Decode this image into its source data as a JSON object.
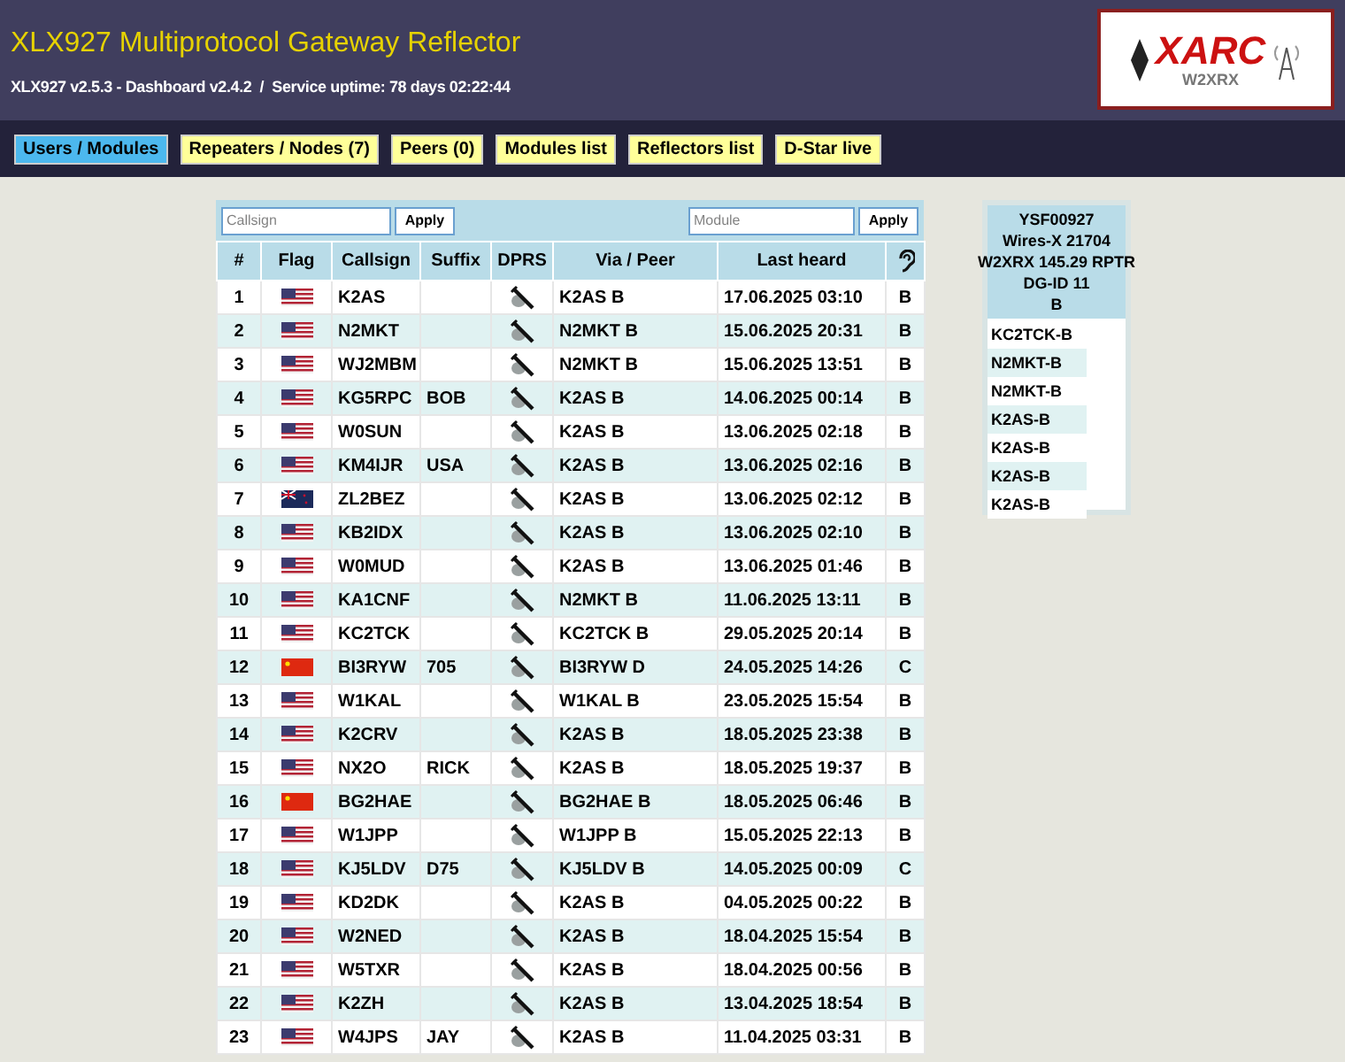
{
  "header": {
    "title": "XLX927 Multiprotocol Gateway Reflector",
    "subtitle": "XLX927 v2.5.3 - Dashboard v2.4.2  /  Service uptime: 78 days 02:22:44",
    "logo": {
      "name": "XARC",
      "call": "W2XRX"
    }
  },
  "nav": [
    {
      "label": "Users / Modules",
      "selected": true
    },
    {
      "label": "Repeaters / Nodes (7)",
      "selected": false
    },
    {
      "label": "Peers (0)",
      "selected": false
    },
    {
      "label": "Modules list",
      "selected": false
    },
    {
      "label": "Reflectors list",
      "selected": false
    },
    {
      "label": "D-Star live",
      "selected": false
    }
  ],
  "filters": [
    {
      "placeholder": "Callsign",
      "button": "Apply"
    },
    {
      "placeholder": "Module",
      "button": "Apply"
    }
  ],
  "table": {
    "columns": [
      "#",
      "Flag",
      "Callsign",
      "Suffix",
      "DPRS",
      "Via / Peer",
      "Last heard"
    ],
    "rows": [
      {
        "n": "1",
        "flag": {
          "kind": "us"
        },
        "callsign": "K2AS",
        "suffix": "",
        "via": "K2AS B",
        "last": "17.06.2025 03:10",
        "module": "B"
      },
      {
        "n": "2",
        "flag": {
          "kind": "us"
        },
        "callsign": "N2MKT",
        "suffix": "",
        "via": "N2MKT B",
        "last": "15.06.2025 20:31",
        "module": "B"
      },
      {
        "n": "3",
        "flag": {
          "kind": "us"
        },
        "callsign": "WJ2MBM",
        "suffix": "",
        "via": "N2MKT B",
        "last": "15.06.2025 13:51",
        "module": "B"
      },
      {
        "n": "4",
        "flag": {
          "kind": "us"
        },
        "callsign": "KG5RPC",
        "suffix": "BOB",
        "via": "K2AS B",
        "last": "14.06.2025 00:14",
        "module": "B"
      },
      {
        "n": "5",
        "flag": {
          "kind": "us"
        },
        "callsign": "W0SUN",
        "suffix": "",
        "via": "K2AS B",
        "last": "13.06.2025 02:18",
        "module": "B"
      },
      {
        "n": "6",
        "flag": {
          "kind": "us"
        },
        "callsign": "KM4IJR",
        "suffix": "USA",
        "via": "K2AS B",
        "last": "13.06.2025 02:16",
        "module": "B"
      },
      {
        "n": "7",
        "flag": {
          "kind": "nz"
        },
        "callsign": "ZL2BEZ",
        "suffix": "",
        "via": "K2AS B",
        "last": "13.06.2025 02:12",
        "module": "B"
      },
      {
        "n": "8",
        "flag": {
          "kind": "us"
        },
        "callsign": "KB2IDX",
        "suffix": "",
        "via": "K2AS B",
        "last": "13.06.2025 02:10",
        "module": "B"
      },
      {
        "n": "9",
        "flag": {
          "kind": "us"
        },
        "callsign": "W0MUD",
        "suffix": "",
        "via": "K2AS B",
        "last": "13.06.2025 01:46",
        "module": "B"
      },
      {
        "n": "10",
        "flag": {
          "kind": "us"
        },
        "callsign": "KA1CNF",
        "suffix": "",
        "via": "N2MKT B",
        "last": "11.06.2025 13:11",
        "module": "B"
      },
      {
        "n": "11",
        "flag": {
          "kind": "us"
        },
        "callsign": "KC2TCK",
        "suffix": "",
        "via": "KC2TCK B",
        "last": "29.05.2025 20:14",
        "module": "B"
      },
      {
        "n": "12",
        "flag": {
          "kind": "cn"
        },
        "callsign": "BI3RYW",
        "suffix": "705",
        "via": "BI3RYW D",
        "last": "24.05.2025 14:26",
        "module": "C"
      },
      {
        "n": "13",
        "flag": {
          "kind": "us"
        },
        "callsign": "W1KAL",
        "suffix": "",
        "via": "W1KAL B",
        "last": "23.05.2025 15:54",
        "module": "B"
      },
      {
        "n": "14",
        "flag": {
          "kind": "us"
        },
        "callsign": "K2CRV",
        "suffix": "",
        "via": "K2AS B",
        "last": "18.05.2025 23:38",
        "module": "B"
      },
      {
        "n": "15",
        "flag": {
          "kind": "us"
        },
        "callsign": "NX2O",
        "suffix": "RICK",
        "via": "K2AS B",
        "last": "18.05.2025 19:37",
        "module": "B"
      },
      {
        "n": "16",
        "flag": {
          "kind": "cn"
        },
        "callsign": "BG2HAE",
        "suffix": "",
        "via": "BG2HAE B",
        "last": "18.05.2025 06:46",
        "module": "B"
      },
      {
        "n": "17",
        "flag": {
          "kind": "us"
        },
        "callsign": "W1JPP",
        "suffix": "",
        "via": "W1JPP B",
        "last": "15.05.2025 22:13",
        "module": "B"
      },
      {
        "n": "18",
        "flag": {
          "kind": "us"
        },
        "callsign": "KJ5LDV",
        "suffix": "D75",
        "via": "KJ5LDV B",
        "last": "14.05.2025 00:09",
        "module": "C"
      },
      {
        "n": "19",
        "flag": {
          "kind": "us"
        },
        "callsign": "KD2DK",
        "suffix": "",
        "via": "K2AS B",
        "last": "04.05.2025 00:22",
        "module": "B"
      },
      {
        "n": "20",
        "flag": {
          "kind": "us"
        },
        "callsign": "W2NED",
        "suffix": "",
        "via": "K2AS B",
        "last": "18.04.2025 15:54",
        "module": "B"
      },
      {
        "n": "21",
        "flag": {
          "kind": "us"
        },
        "callsign": "W5TXR",
        "suffix": "",
        "via": "K2AS B",
        "last": "18.04.2025 00:56",
        "module": "B"
      },
      {
        "n": "22",
        "flag": {
          "kind": "us"
        },
        "callsign": "K2ZH",
        "suffix": "",
        "via": "K2AS B",
        "last": "13.04.2025 18:54",
        "module": "B"
      },
      {
        "n": "23",
        "flag": {
          "kind": "us"
        },
        "callsign": "W4JPS",
        "suffix": "JAY",
        "via": "K2AS B",
        "last": "11.04.2025 03:31",
        "module": "B"
      }
    ]
  },
  "module_panel": {
    "heading": [
      "YSF00927",
      "Wires-X 21704",
      "W2XRX 145.29 RPTR",
      "DG-ID 11",
      "B"
    ],
    "items": [
      "KC2TCK-B",
      "N2MKT-B",
      "N2MKT-B",
      "K2AS-B",
      "K2AS-B",
      "K2AS-B",
      "K2AS-B"
    ]
  }
}
